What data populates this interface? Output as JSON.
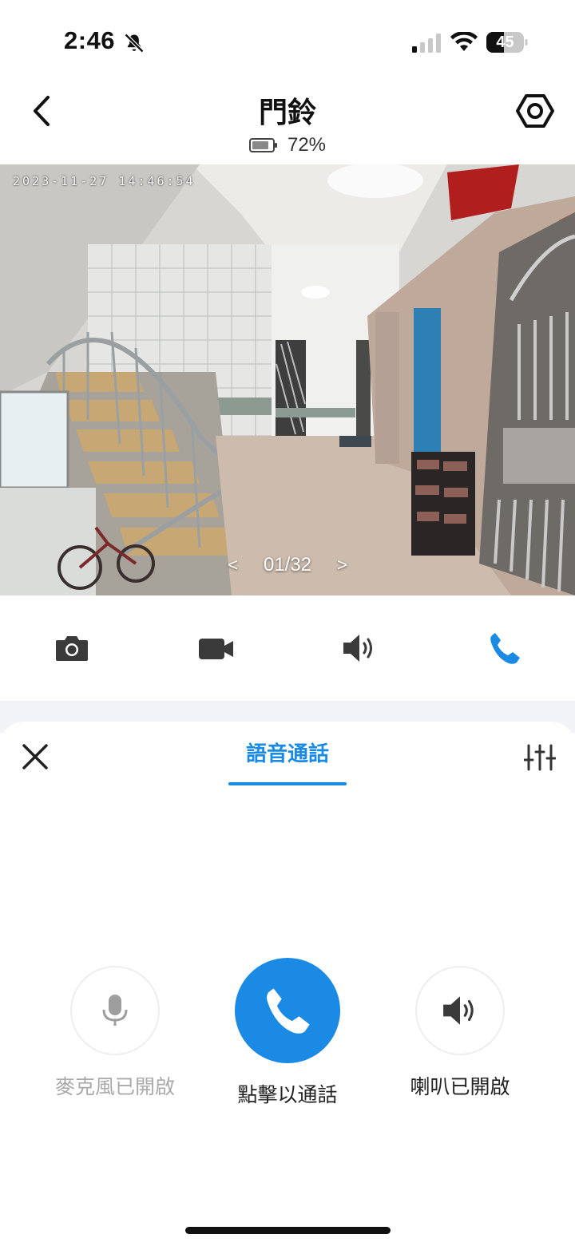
{
  "status_bar": {
    "time": "2:46",
    "battery_level": "45"
  },
  "header": {
    "title": "門鈴",
    "battery_percent": "72%"
  },
  "camera": {
    "timestamp": "2023-11-27  14:46:54",
    "prev": "<",
    "page": "01/32",
    "next": ">"
  },
  "controls": {
    "icons": [
      "camera-icon",
      "video-icon",
      "speaker-icon",
      "phone-icon"
    ],
    "active_color": "#1a8ae5",
    "inactive_color": "#3a3a3a"
  },
  "sheet": {
    "tab_label": "語音通話",
    "actions": [
      {
        "label": "麥克風已開啟",
        "icon": "microphone-icon",
        "enabled": false
      },
      {
        "label": "點擊以通話",
        "icon": "phone-icon",
        "enabled": true
      },
      {
        "label": "喇叭已開啟",
        "icon": "speaker-icon",
        "enabled": true
      }
    ]
  },
  "colors": {
    "accent": "#1a8ae5",
    "separator": "#f1f3f6"
  }
}
